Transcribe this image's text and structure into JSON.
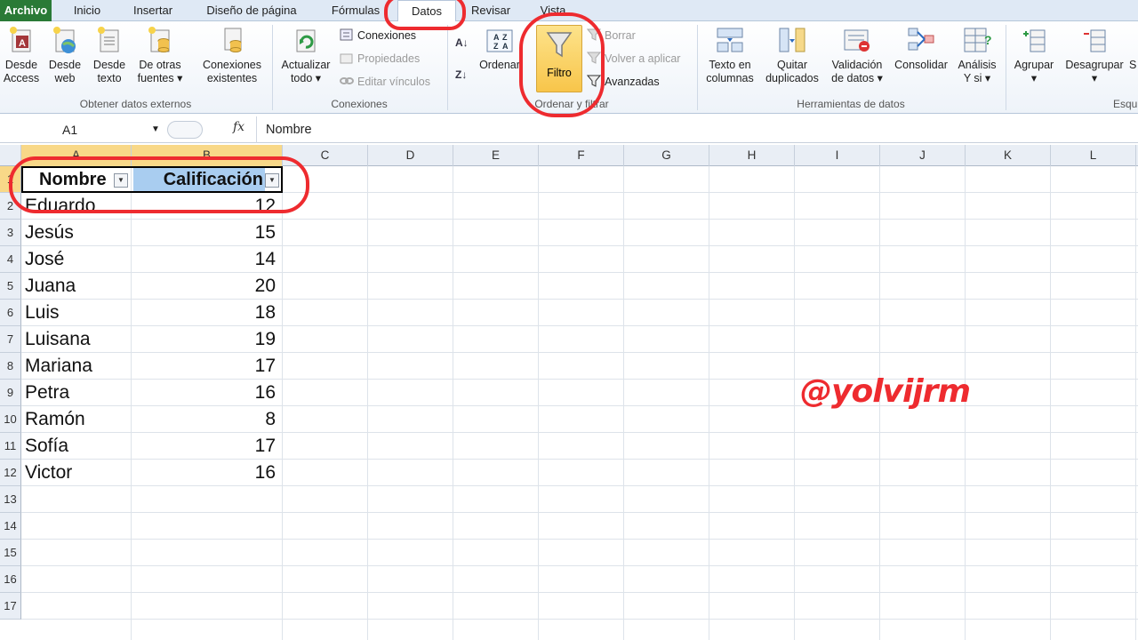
{
  "tabs": {
    "file": "Archivo",
    "inicio": "Inicio",
    "insertar": "Insertar",
    "diseno": "Diseño de página",
    "formulas": "Fórmulas",
    "datos": "Datos",
    "revisar": "Revisar",
    "vista": "Vista"
  },
  "ribbon": {
    "externos": {
      "access": [
        "Desde",
        "Access"
      ],
      "web": [
        "Desde",
        "web"
      ],
      "texto": [
        "Desde",
        "texto"
      ],
      "otras": [
        "De otras",
        "fuentes ▾"
      ],
      "existentes": [
        "Conexiones",
        "existentes"
      ],
      "group_label": "Obtener datos externos"
    },
    "conexiones": {
      "actualizar": [
        "Actualizar",
        "todo ▾"
      ],
      "conexiones": "Conexiones",
      "propiedades": "Propiedades",
      "editar": "Editar vínculos",
      "group_label": "Conexiones"
    },
    "ordenar": {
      "ordenar": "Ordenar",
      "filtro": "Filtro",
      "borrar": "Borrar",
      "volver": "Volver a aplicar",
      "avanzadas": "Avanzadas",
      "group_label": "Ordenar y filtrar"
    },
    "herramientas": {
      "texto_col": [
        "Texto en",
        "columnas"
      ],
      "quitar": [
        "Quitar",
        "duplicados"
      ],
      "validacion": [
        "Validación",
        "de datos ▾"
      ],
      "consolidar": "Consolidar",
      "analisis": [
        "Análisis",
        "Y si ▾"
      ],
      "group_label": "Herramientas de datos"
    },
    "esquema": {
      "agrupar": [
        "Agrupar",
        "▾"
      ],
      "desagrupar": [
        "Desagrupar",
        "▾"
      ],
      "subtotal": "S",
      "group_label": "Esqu"
    }
  },
  "formula_bar": {
    "name_box": "A1",
    "fx": "fx",
    "content": "Nombre"
  },
  "columns": [
    "A",
    "B",
    "C",
    "D",
    "E",
    "F",
    "G",
    "H",
    "I",
    "J",
    "K",
    "L"
  ],
  "rows": [
    "1",
    "2",
    "3",
    "4",
    "5",
    "6",
    "7",
    "8",
    "9",
    "10",
    "11",
    "12",
    "13",
    "14",
    "15",
    "16",
    "17"
  ],
  "table": {
    "headers": [
      "Nombre",
      "Calificación"
    ],
    "data": [
      {
        "nombre": "Eduardo",
        "calificacion": "12"
      },
      {
        "nombre": "Jesús",
        "calificacion": "15"
      },
      {
        "nombre": "José",
        "calificacion": "14"
      },
      {
        "nombre": "Juana",
        "calificacion": "20"
      },
      {
        "nombre": "Luis",
        "calificacion": "18"
      },
      {
        "nombre": "Luisana",
        "calificacion": "19"
      },
      {
        "nombre": "Mariana",
        "calificacion": "17"
      },
      {
        "nombre": "Petra",
        "calificacion": "16"
      },
      {
        "nombre": "Ramón",
        "calificacion": "8"
      },
      {
        "nombre": "Sofía",
        "calificacion": "17"
      },
      {
        "nombre": "Victor",
        "calificacion": "16"
      }
    ]
  },
  "watermark": "@yolvijrm",
  "colors": {
    "file_tab": "#2a7a36",
    "highlight_red": "#ee2b2f",
    "filter_active": "#f8c54a",
    "selected_header": "#f8d888"
  }
}
